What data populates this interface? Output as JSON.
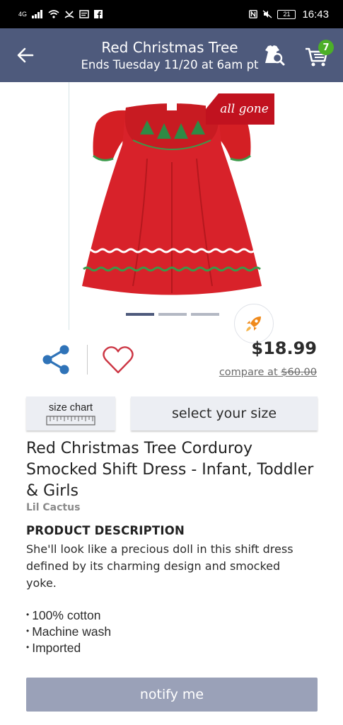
{
  "status_bar": {
    "network": "4G",
    "battery": "21",
    "time": "16:43"
  },
  "header": {
    "title": "Red Christmas Tree",
    "subtitle": "Ends Tuesday 11/20 at 6am pt",
    "cart_count": "7",
    "color": "#4e5a7c"
  },
  "product_image": {
    "badge": "all gone",
    "badge_color": "#c1121f",
    "carousel": {
      "total": 3,
      "active": 1
    }
  },
  "pricing": {
    "price": "$18.99",
    "compare_label": "compare at",
    "compare_price": "$60.00"
  },
  "actions": {
    "size_chart_label": "size chart",
    "select_size_label": "select your size",
    "notify_label": "notify me"
  },
  "product": {
    "title": "Red Christmas Tree Corduroy Smocked Shift Dress - Infant, Toddler & Girls",
    "brand": "Lil Cactus",
    "description_heading": "PRODUCT DESCRIPTION",
    "description": "She'll look like a precious doll in this shift dress defined by its charming design and smocked yoke.",
    "features": [
      "100% cotton",
      "Machine wash",
      "Imported"
    ]
  },
  "icons": {
    "back": "arrow-left-icon",
    "search_product": "dress-search-icon",
    "cart": "cart-icon",
    "share": "share-icon",
    "favorite": "heart-icon",
    "rocket": "rocket-icon",
    "ruler": "ruler-icon"
  }
}
